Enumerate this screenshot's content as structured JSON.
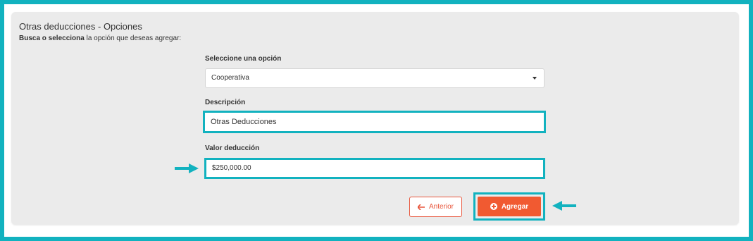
{
  "header": {
    "title": "Otras deducciones - Opciones",
    "subtitle_bold": "Busca o selecciona",
    "subtitle_rest": " la opción que deseas agregar:"
  },
  "form": {
    "select_label": "Seleccione una opción",
    "select_value": "Cooperativa",
    "description_label": "Descripción",
    "description_value": "Otras Deducciones",
    "value_label": "Valor deducción",
    "value_value": "$250,000.00"
  },
  "actions": {
    "back_label": "Anterior",
    "add_label": "Agregar"
  },
  "icons": {
    "back": "arrow-left-icon",
    "add": "plus-circle-icon",
    "select": "caret-down-icon",
    "callout": "arrow-pointer-icon"
  },
  "colors": {
    "highlight": "#12b2bf",
    "accent": "#f15a31",
    "panel": "#ebebeb"
  }
}
